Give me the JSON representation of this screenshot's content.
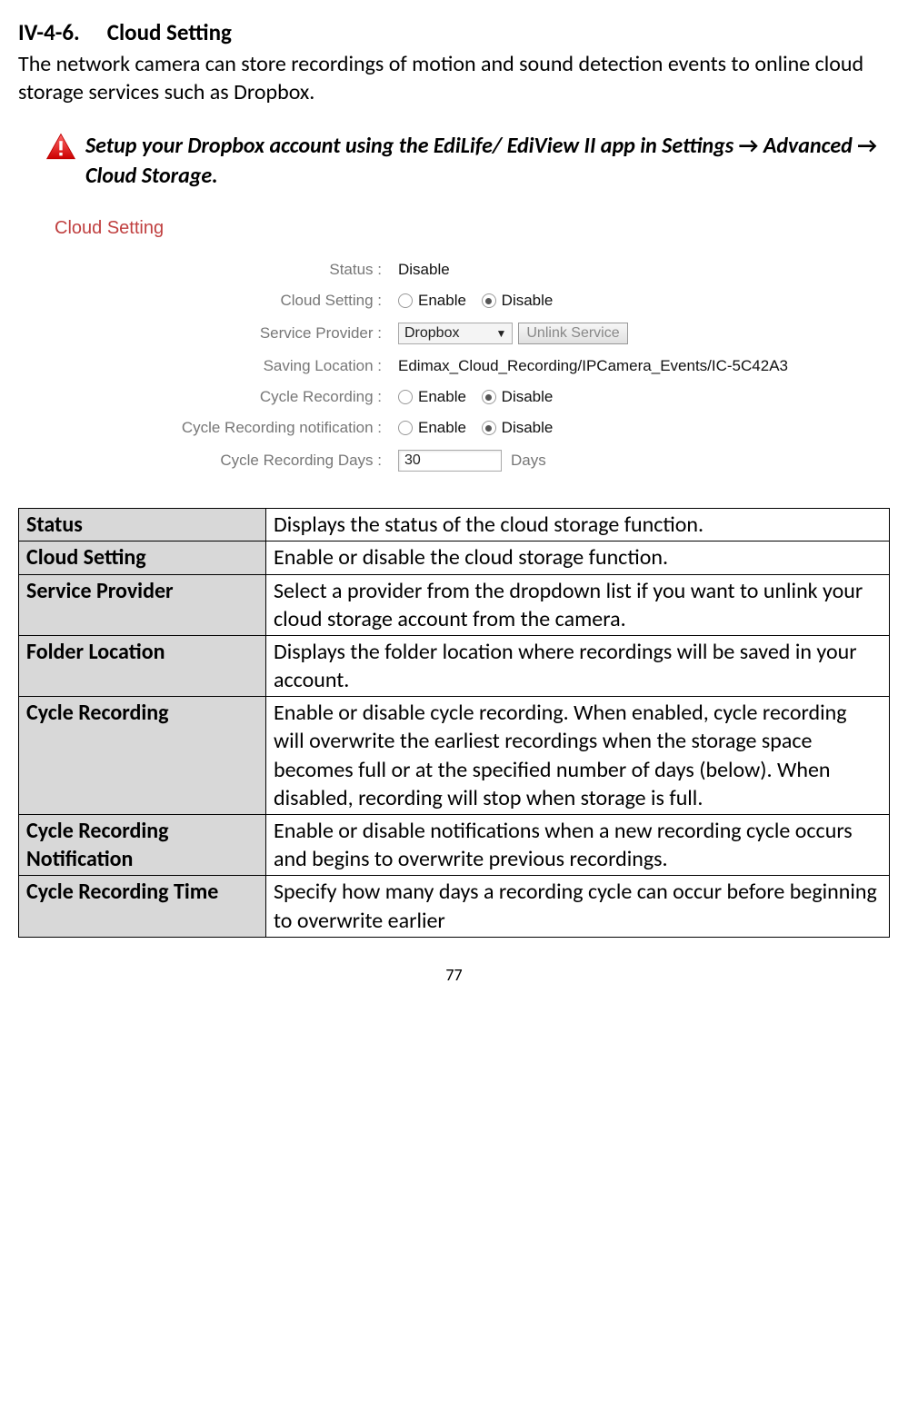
{
  "heading": {
    "number": "IV-4-6.",
    "title": "Cloud Setting"
  },
  "intro": "The network camera can store recordings of motion and sound detection events to online cloud storage services such as Dropbox.",
  "note": {
    "part1": "Setup your Dropbox account using the EdiLife/ EdiView II app in Settings ",
    "arrow": "→",
    "part2": " Advanced ",
    "part3": " Cloud Storage."
  },
  "panel": {
    "title": "Cloud Setting",
    "fields": {
      "status_label": "Status :",
      "status_value": "Disable",
      "cloud_setting_label": "Cloud Setting :",
      "enable_text": "Enable",
      "disable_text": "Disable",
      "service_provider_label": "Service Provider :",
      "service_provider_value": "Dropbox",
      "unlink_button": "Unlink Service",
      "saving_location_label": "Saving Location :",
      "saving_location_value": "Edimax_Cloud_Recording/IPCamera_Events/IC-5C42A3",
      "cycle_recording_label": "Cycle Recording :",
      "cycle_notification_label": "Cycle Recording notification :",
      "cycle_days_label": "Cycle Recording Days :",
      "cycle_days_value": "30",
      "days_suffix": "Days"
    }
  },
  "table": {
    "rows": [
      {
        "label": "Status",
        "desc": "Displays the status of the cloud storage function."
      },
      {
        "label": "Cloud Setting",
        "desc": "Enable or disable the cloud storage function."
      },
      {
        "label": "Service Provider",
        "desc": "Select a provider from the dropdown list if you want to unlink your cloud storage account from the camera."
      },
      {
        "label": "Folder Location",
        "desc": "Displays the folder location where recordings will be saved in your account."
      },
      {
        "label": "Cycle Recording",
        "desc": "Enable or disable cycle recording. When enabled, cycle recording will overwrite the earliest recordings when the storage space becomes full or at the specified number of days (below). When disabled, recording will stop when storage is full."
      },
      {
        "label": "Cycle Recording Notification",
        "desc": "Enable or disable notifications when a new recording cycle occurs and begins to overwrite previous recordings."
      },
      {
        "label": "Cycle Recording Time",
        "desc": "Specify how many days a recording cycle can occur before beginning to overwrite earlier"
      }
    ]
  },
  "page_number": "77"
}
